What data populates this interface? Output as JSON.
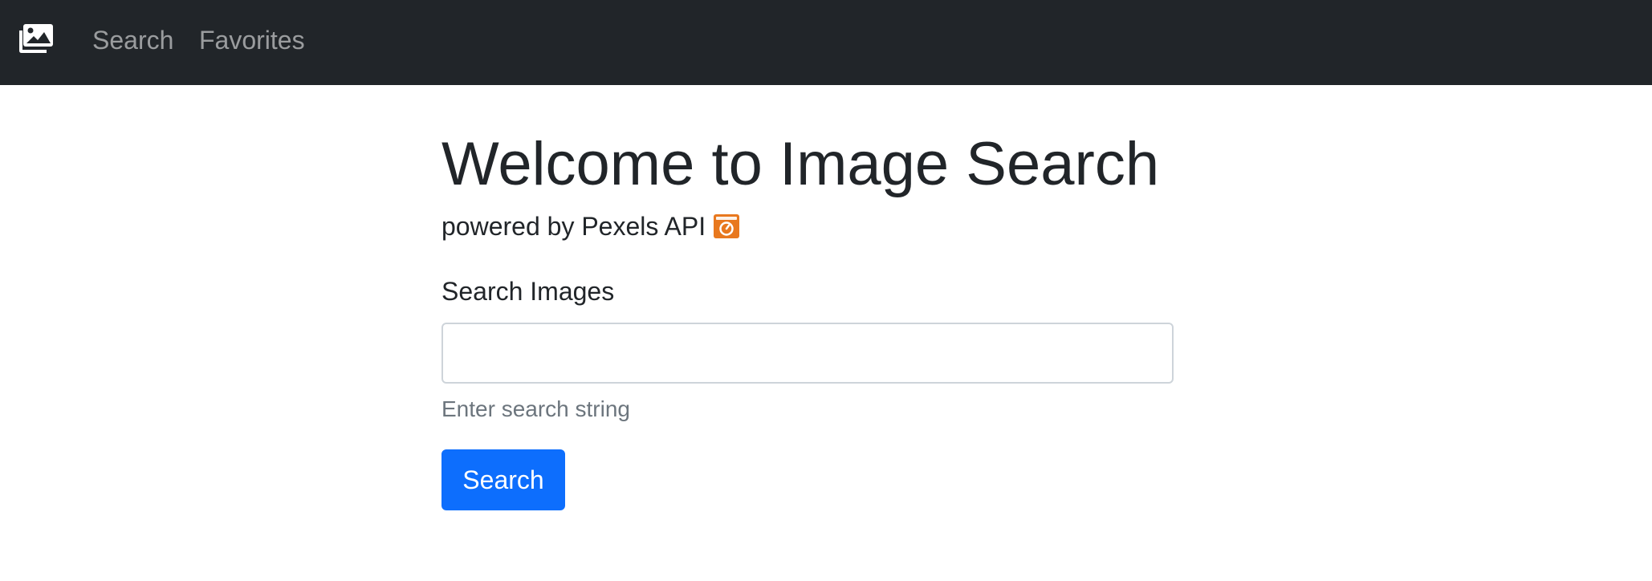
{
  "navbar": {
    "brand_icon": "images-icon",
    "links": [
      {
        "label": "Search"
      },
      {
        "label": "Favorites"
      }
    ],
    "background_color": "#212529"
  },
  "main": {
    "title": "Welcome to Image Search",
    "subtitle": "powered by Pexels API",
    "subtitle_icon": "pexels-camera-icon",
    "search_label": "Search Images",
    "search_input": {
      "value": "",
      "placeholder": ""
    },
    "help_text": "Enter search string",
    "search_button_label": "Search"
  },
  "colors": {
    "primary": "#0d6efd",
    "pexels_orange": "#E8781E",
    "muted_text": "#6c757d"
  }
}
